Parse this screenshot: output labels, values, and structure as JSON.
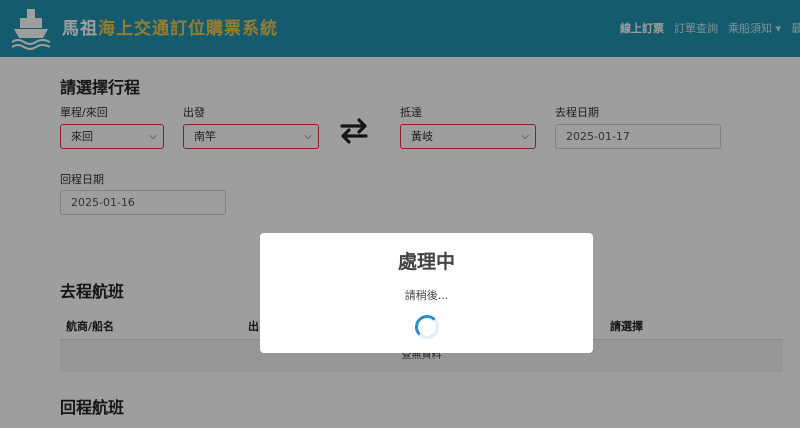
{
  "header": {
    "brand_part1": "馬祖",
    "brand_part2": "海上交通訂位購票系統",
    "nav": [
      "線上訂票",
      "訂單查詢",
      "乘船須知 ▾",
      "最新"
    ]
  },
  "trip": {
    "title": "請選擇行程",
    "type_label": "單程/來回",
    "type_value": "來回",
    "from_label": "出發",
    "from_value": "南竿",
    "to_label": "抵達",
    "to_value": "黃岐",
    "depart_label": "去程日期",
    "depart_value": "2025-01-17",
    "return_label": "回程日期",
    "return_value": "2025-01-16"
  },
  "outbound": {
    "title": "去程航班",
    "headers": [
      "航商/船名",
      "出",
      "請選擇"
    ],
    "empty": "查無資料"
  },
  "inbound": {
    "title": "回程航班"
  },
  "modal": {
    "title": "處理中",
    "text": "請稍後..."
  },
  "colors": {
    "header": "#1f94b1",
    "accent": "#f2c94c",
    "error_border": "#dc3545",
    "spinner": "#2d8cd2"
  }
}
